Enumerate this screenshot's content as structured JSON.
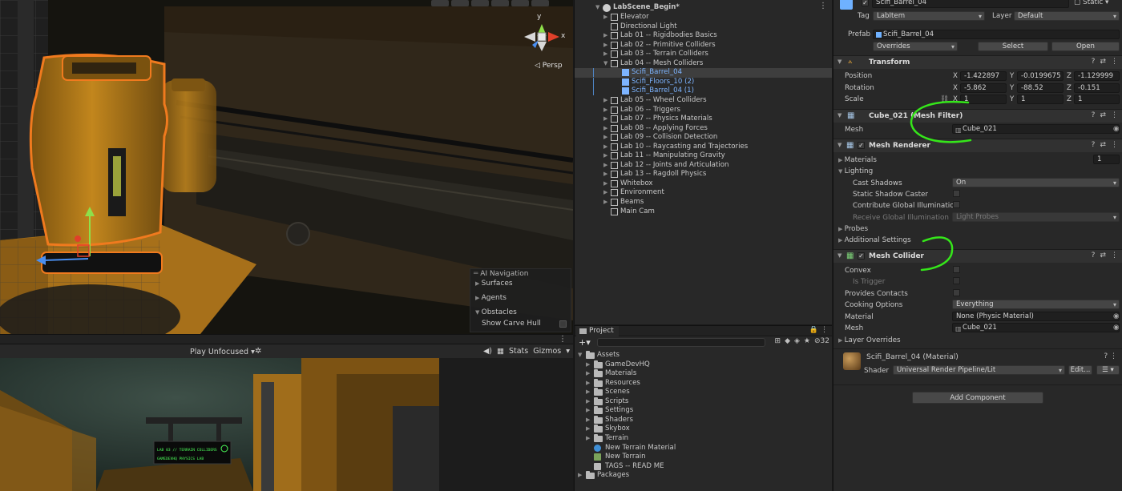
{
  "scene": {
    "persp_label": "◁ Persp",
    "gizmo_axis_y": "y",
    "gizmo_axis_x": "x",
    "ai_navigation": {
      "title": "AI Navigation",
      "items": [
        "Surfaces",
        "Agents",
        "Obstacles"
      ],
      "option_label": "Show Carve Hull"
    }
  },
  "game": {
    "play_mode": "Play Unfocused",
    "stats_label": "Stats",
    "gizmos_label": "Gizmos",
    "sign_line1": "LAB 03 // TERRAIN COLLIDERS",
    "sign_line2": "GAMEDEVHQ PHYSICS LAB"
  },
  "hierarchy": {
    "scene_name": "LabScene_Begin*",
    "items": [
      {
        "label": "Elevator",
        "depth": 1,
        "arrow": true
      },
      {
        "label": "Directional Light",
        "depth": 1,
        "arrow": false
      },
      {
        "label": "Lab 01 -- Rigidbodies Basics",
        "depth": 1,
        "arrow": true
      },
      {
        "label": "Lab 02 -- Primitive Colliders",
        "depth": 1,
        "arrow": true
      },
      {
        "label": "Lab 03 -- Terrain Colliders",
        "depth": 1,
        "arrow": true
      },
      {
        "label": "Lab 04 -- Mesh Colliders",
        "depth": 1,
        "arrow": true,
        "open": true
      },
      {
        "label": "Scifi_Barrel_04",
        "depth": 2,
        "arrow": false,
        "prefab": true,
        "selected": true
      },
      {
        "label": "Scifi_Floors_10 (2)",
        "depth": 2,
        "arrow": false,
        "prefab": true
      },
      {
        "label": "Scifi_Barrel_04 (1)",
        "depth": 2,
        "arrow": false,
        "prefab": true
      },
      {
        "label": "Lab 05 -- Wheel Colliders",
        "depth": 1,
        "arrow": true
      },
      {
        "label": "Lab 06 -- Triggers",
        "depth": 1,
        "arrow": true
      },
      {
        "label": "Lab 07 -- Physics Materials",
        "depth": 1,
        "arrow": true
      },
      {
        "label": "Lab 08 -- Applying Forces",
        "depth": 1,
        "arrow": true
      },
      {
        "label": "Lab 09 -- Collision Detection",
        "depth": 1,
        "arrow": true
      },
      {
        "label": "Lab 10 -- Raycasting and Trajectories",
        "depth": 1,
        "arrow": true
      },
      {
        "label": "Lab 11 -- Manipulating Gravity",
        "depth": 1,
        "arrow": true
      },
      {
        "label": "Lab 12 -- Joints and Articulation",
        "depth": 1,
        "arrow": true
      },
      {
        "label": "Lab 13 -- Ragdoll Physics",
        "depth": 1,
        "arrow": true
      },
      {
        "label": "Whitebox",
        "depth": 1,
        "arrow": true
      },
      {
        "label": "Environment",
        "depth": 1,
        "arrow": true
      },
      {
        "label": "Beams",
        "depth": 1,
        "arrow": true
      },
      {
        "label": "Main Cam",
        "depth": 1,
        "arrow": false
      }
    ]
  },
  "project": {
    "tab_label": "Project",
    "hidden_count": "32",
    "items": [
      {
        "label": "Assets",
        "depth": 0,
        "type": "folder",
        "arrow": "open"
      },
      {
        "label": "GameDevHQ",
        "depth": 1,
        "type": "folder",
        "arrow": "closed"
      },
      {
        "label": "Materials",
        "depth": 1,
        "type": "folder",
        "arrow": "closed"
      },
      {
        "label": "Resources",
        "depth": 1,
        "type": "folder",
        "arrow": "closed"
      },
      {
        "label": "Scenes",
        "depth": 1,
        "type": "folder",
        "arrow": "closed"
      },
      {
        "label": "Scripts",
        "depth": 1,
        "type": "folder",
        "arrow": "closed"
      },
      {
        "label": "Settings",
        "depth": 1,
        "type": "folder",
        "arrow": "closed"
      },
      {
        "label": "Shaders",
        "depth": 1,
        "type": "folder",
        "arrow": "closed"
      },
      {
        "label": "Skybox",
        "depth": 1,
        "type": "folder",
        "arrow": "closed"
      },
      {
        "label": "Terrain",
        "depth": 1,
        "type": "folder",
        "arrow": "closed"
      },
      {
        "label": "New Terrain Material",
        "depth": 1,
        "type": "material",
        "arrow": "none"
      },
      {
        "label": "New Terrain",
        "depth": 1,
        "type": "terrain",
        "arrow": "none"
      },
      {
        "label": "TAGS -- READ ME",
        "depth": 1,
        "type": "text",
        "arrow": "none"
      },
      {
        "label": "Packages",
        "depth": 0,
        "type": "folder",
        "arrow": "closed"
      }
    ]
  },
  "inspector": {
    "object_name": "Scifi_Barrel_04",
    "static_label": "Static",
    "tag_label": "Tag",
    "tag_value": "LabItem",
    "layer_label": "Layer",
    "layer_value": "Default",
    "prefab_label": "Prefab",
    "prefab_value": "Scifi_Barrel_04",
    "overrides_label": "Overrides",
    "select_label": "Select",
    "open_label": "Open",
    "transform": {
      "title": "Transform",
      "position_label": "Position",
      "rotation_label": "Rotation",
      "scale_label": "Scale",
      "position": {
        "x": "-1.422897",
        "y": "-0.0199675",
        "z": "-1.129999"
      },
      "rotation": {
        "x": "-5.862",
        "y": "-88.52",
        "z": "-0.151"
      },
      "scale": {
        "x": "1",
        "y": "1",
        "z": "1"
      }
    },
    "mesh_filter": {
      "title": "Cube_021 (Mesh Filter)",
      "mesh_label": "Mesh",
      "mesh_value": "Cube_021"
    },
    "mesh_renderer": {
      "title": "Mesh Renderer",
      "materials_label": "Materials",
      "materials_count": "1",
      "lighting_label": "Lighting",
      "cast_shadows_label": "Cast Shadows",
      "cast_shadows_value": "On",
      "static_shadow_label": "Static Shadow Caster",
      "contribute_gi_label": "Contribute Global Illumination",
      "receive_gi_label": "Receive Global Illumination",
      "receive_gi_value": "Light Probes",
      "probes_label": "Probes",
      "additional_label": "Additional Settings"
    },
    "mesh_collider": {
      "title": "Mesh Collider",
      "convex_label": "Convex",
      "is_trigger_label": "Is Trigger",
      "provides_contacts_label": "Provides Contacts",
      "cooking_label": "Cooking Options",
      "cooking_value": "Everything",
      "material_label": "Material",
      "material_value": "None (Physic Material)",
      "mesh_label": "Mesh",
      "mesh_value": "Cube_021",
      "layer_overrides_label": "Layer Overrides"
    },
    "material": {
      "title": "Scifi_Barrel_04 (Material)",
      "shader_label": "Shader",
      "shader_value": "Universal Render Pipeline/Lit",
      "edit_label": "Edit..."
    },
    "add_component_label": "Add Component"
  },
  "colors": {
    "selection_outline": "#f07a1e",
    "barrel": "#c2861d",
    "prefab_blue": "#7db4ff",
    "annotation_green": "#35e61a"
  }
}
